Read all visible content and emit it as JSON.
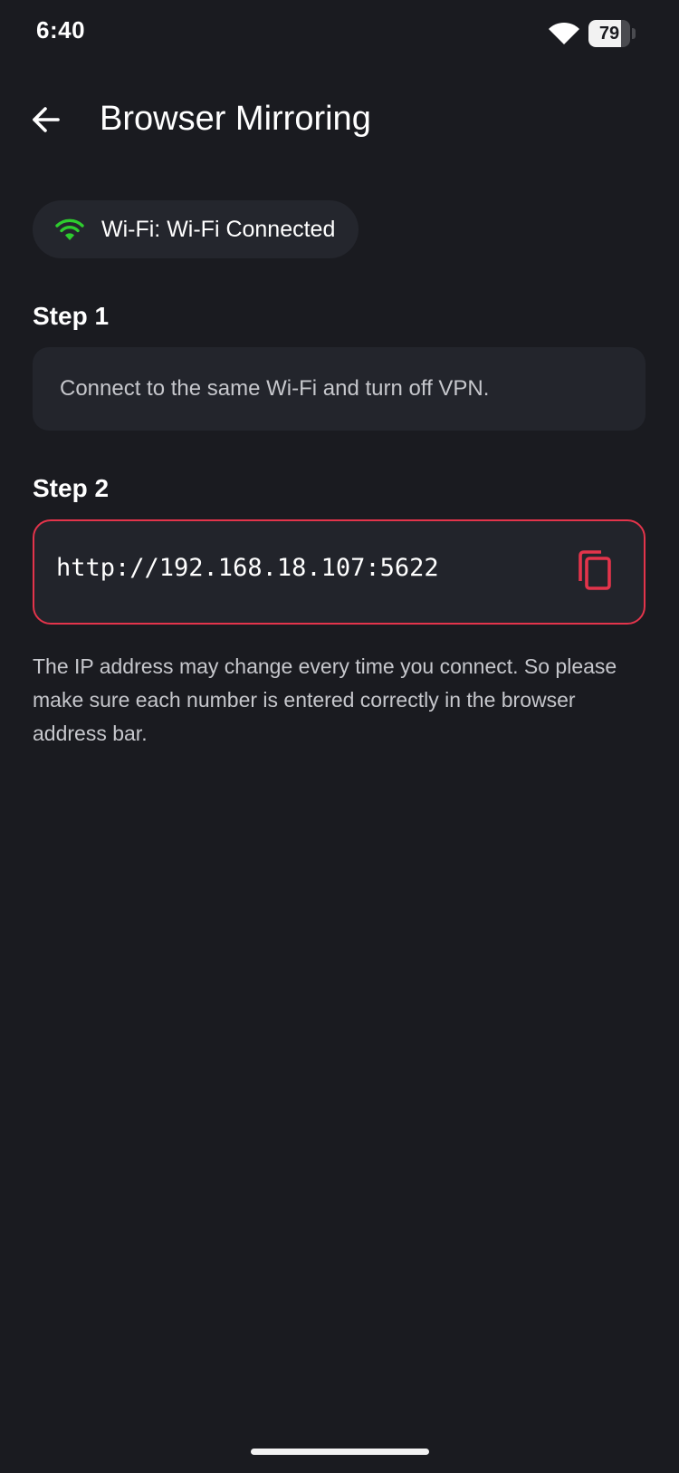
{
  "status_bar": {
    "time": "6:40",
    "battery_level": "79",
    "battery_fraction": 0.79,
    "icons": [
      "wifi-icon",
      "battery-icon"
    ]
  },
  "header": {
    "back_icon": "arrow-left-icon",
    "title": "Browser Mirroring"
  },
  "wifi_status": {
    "icon": "wifi-icon",
    "label": "Wi-Fi: Wi-Fi Connected",
    "icon_color": "#2ecc2e"
  },
  "steps": [
    {
      "label": "Step 1",
      "text": "Connect to the same Wi-Fi and turn off VPN."
    },
    {
      "label": "Step 2",
      "url": "http://192.168.18.107:5622",
      "copy_icon": "copy-icon"
    }
  ],
  "note": "The IP address may change every time you connect. So please make sure each number is entered correctly in the browser address bar.",
  "colors": {
    "background": "#1a1b20",
    "card": "#23252c",
    "accent": "#e3344b",
    "success": "#2ecc2e"
  }
}
